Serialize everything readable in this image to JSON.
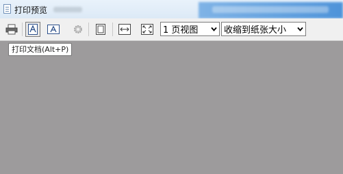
{
  "window": {
    "title": "打印预览"
  },
  "icons": {
    "app": "document-icon",
    "print": "printer-icon",
    "portrait": "portrait-text-icon",
    "landscape": "landscape-text-icon",
    "settings": "gear-icon",
    "single_page": "single-page-icon",
    "fit_width": "fit-width-icon",
    "fit_page": "fit-page-icon"
  },
  "toolbar": {
    "page_view_select": {
      "selected": "1 页视图"
    },
    "zoom_select": {
      "selected": "收缩到纸张大小"
    }
  },
  "tooltip": {
    "text": "打印文档(Alt+P)"
  },
  "colors": {
    "preview_background": "#9d9b9c",
    "toolbar_background": "#f0f0f0"
  }
}
